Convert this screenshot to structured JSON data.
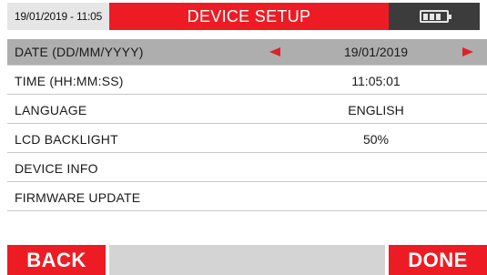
{
  "header": {
    "datetime": "19/01/2019 - 11:05",
    "title": "DEVICE SETUP",
    "battery_icon": "battery-full-icon"
  },
  "menu": {
    "items": [
      {
        "label": "DATE (DD/MM/YYYY)",
        "value": "19/01/2019",
        "selected": true
      },
      {
        "label": "TIME (HH:MM:SS)",
        "value": "11:05:01"
      },
      {
        "label": "LANGUAGE",
        "value": "ENGLISH"
      },
      {
        "label": "LCD BACKLIGHT",
        "value": "50%"
      },
      {
        "label": "DEVICE INFO",
        "value": ""
      },
      {
        "label": "FIRMWARE UPDATE",
        "value": ""
      }
    ]
  },
  "footer": {
    "back_label": "BACK",
    "done_label": "DONE"
  },
  "colors": {
    "accent_red": "#ed1c24",
    "arrow_red": "#e0202a",
    "selected_row": "#aeaeae"
  }
}
